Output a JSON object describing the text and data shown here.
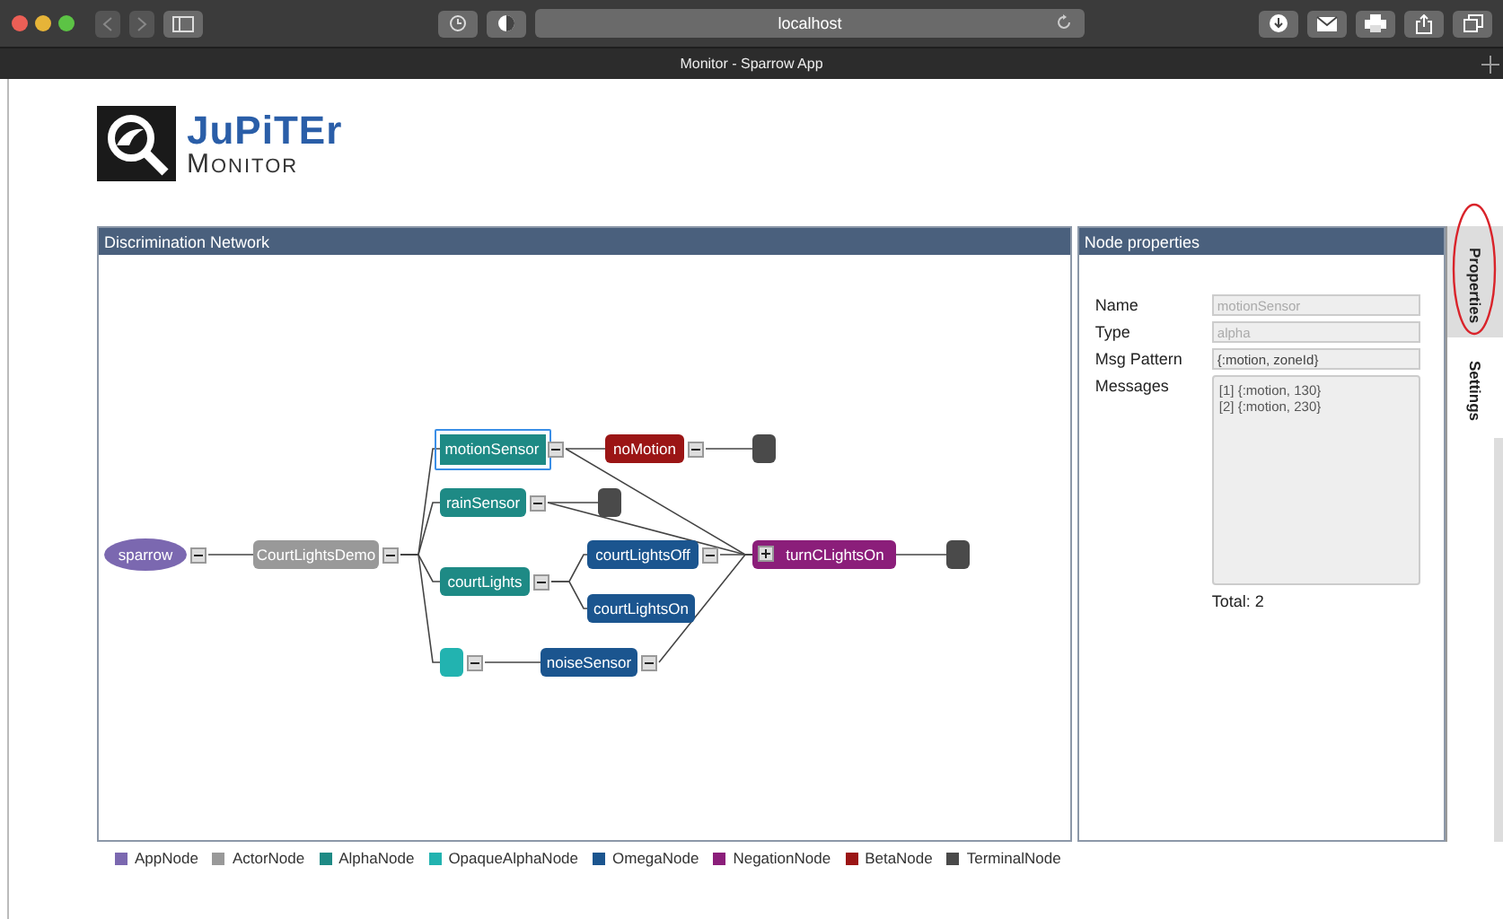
{
  "browser": {
    "address": "localhost",
    "tab_title": "Monitor - Sparrow App"
  },
  "logo": {
    "title": "JuPiTEr",
    "subtitle": "Monitor"
  },
  "network": {
    "title": "Discrimination Network",
    "nodes": [
      {
        "label": "sparrow",
        "kind": "app",
        "selected": false,
        "expanded": true
      },
      {
        "label": "CourtLightsDemo",
        "kind": "actor",
        "selected": false,
        "expanded": true
      },
      {
        "label": "motionSensor",
        "kind": "alpha",
        "selected": true,
        "expanded": true
      },
      {
        "label": "rainSensor",
        "kind": "alpha",
        "selected": false,
        "expanded": true
      },
      {
        "label": "courtLights",
        "kind": "alpha",
        "selected": false,
        "expanded": true
      },
      {
        "kind": "opaque_alpha",
        "selected": false,
        "expanded": true
      },
      {
        "label": "noMotion",
        "kind": "beta",
        "selected": false,
        "expanded": true
      },
      {
        "kind": "terminal",
        "selected": false
      },
      {
        "kind": "terminal",
        "selected": false
      },
      {
        "label": "courtLightsOff",
        "kind": "omega",
        "selected": false,
        "expanded": true
      },
      {
        "label": "courtLightsOn",
        "kind": "omega",
        "selected": false
      },
      {
        "label": "noiseSensor",
        "kind": "omega",
        "selected": false,
        "expanded": true
      },
      {
        "label": "turnCLightsOn",
        "kind": "negation",
        "selected": false,
        "expanded": false
      },
      {
        "kind": "terminal",
        "selected": false
      }
    ]
  },
  "properties": {
    "title": "Node properties",
    "fields": [
      {
        "label": "Name",
        "value": "motionSensor",
        "disabled": true
      },
      {
        "label": "Type",
        "value": "alpha",
        "disabled": true
      },
      {
        "label": "Msg Pattern",
        "value": "{:motion, zoneId}",
        "disabled": false
      }
    ],
    "messages_label": "Messages",
    "messages": [
      "[1] {:motion, 130}",
      "[2] {:motion, 230}"
    ],
    "total": "Total: 2"
  },
  "side_tabs": [
    {
      "label": "Properties",
      "selected": true,
      "circled": true
    },
    {
      "label": "Settings",
      "selected": false,
      "circled": false
    }
  ],
  "legend": [
    {
      "label": "AppNode",
      "kind": "app",
      "color": "#7b68b0"
    },
    {
      "label": "ActorNode",
      "kind": "actor",
      "color": "#999999"
    },
    {
      "label": "AlphaNode",
      "kind": "alpha",
      "color": "#1e8a85"
    },
    {
      "label": "OpaqueAlphaNode",
      "kind": "opaque_alpha",
      "color": "#22b3b0"
    },
    {
      "label": "OmegaNode",
      "kind": "omega",
      "color": "#1b558f"
    },
    {
      "label": "NegationNode",
      "kind": "negation",
      "color": "#8b1e7a"
    },
    {
      "label": "BetaNode",
      "kind": "beta",
      "color": "#9b1515"
    },
    {
      "label": "TerminalNode",
      "kind": "terminal",
      "color": "#4a4a4a"
    }
  ]
}
